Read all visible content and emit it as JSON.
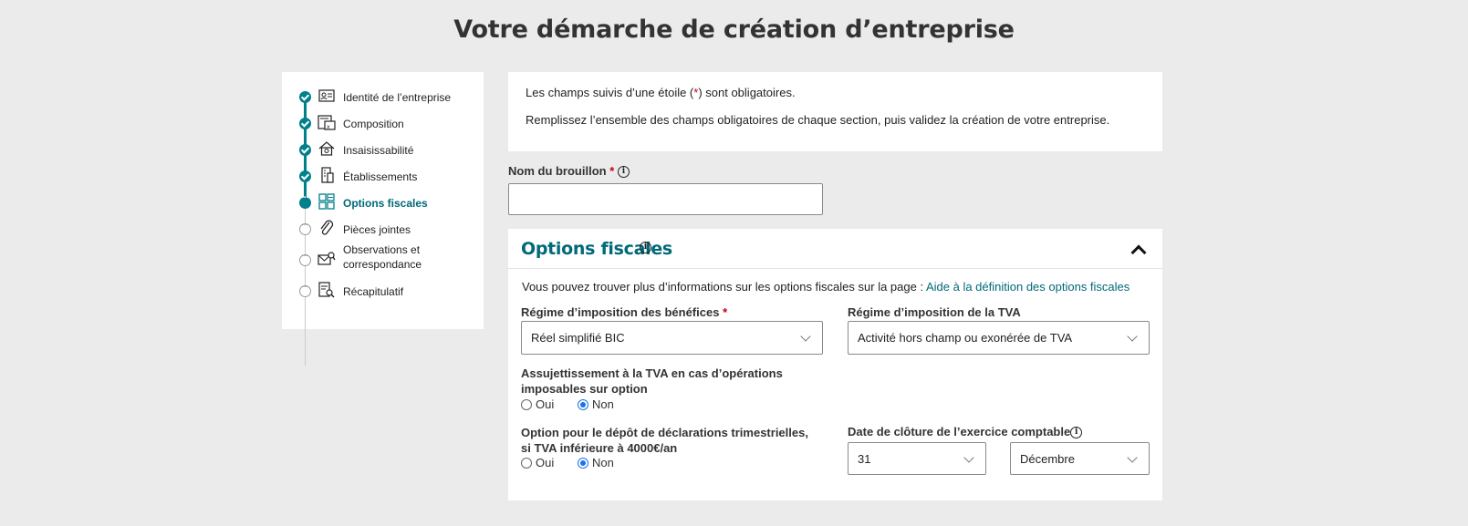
{
  "page": {
    "title": "Votre démarche de création d’entreprise"
  },
  "stepper": {
    "steps": [
      {
        "label": "Identité de l’entreprise",
        "status": "done",
        "icon": "id-card-icon"
      },
      {
        "label": "Composition",
        "status": "done",
        "icon": "people-document-icon"
      },
      {
        "label": "Insaisissabilité",
        "status": "done",
        "icon": "house-icon"
      },
      {
        "label": "Établissements",
        "status": "done",
        "icon": "building-icon"
      },
      {
        "label": "Options fiscales",
        "status": "current",
        "icon": "grid-options-icon"
      },
      {
        "label": "Pièces jointes",
        "status": "todo",
        "icon": "paperclip-icon"
      },
      {
        "label": "Observations et correspondance",
        "status": "todo",
        "icon": "mail-search-icon"
      },
      {
        "label": "Récapitulatif",
        "status": "todo",
        "icon": "document-search-icon"
      }
    ]
  },
  "info": {
    "line1_prefix": "Les champs suivis d’une étoile (",
    "line1_star": "*",
    "line1_suffix": ") sont obligatoires.",
    "line2": "Remplissez l’ensemble des champs obligatoires de chaque section, puis validez la création de votre entreprise."
  },
  "draft": {
    "label": "Nom du brouillon",
    "required_mark": "*",
    "value": ""
  },
  "section": {
    "title": "Options fiscales",
    "intro_text": "Vous pouvez trouver plus d’informations sur les options fiscales sur la page : ",
    "intro_link": "Aide à la définition des options fiscales",
    "benefits_regime": {
      "label": "Régime d’imposition des bénéfices",
      "required_mark": "*",
      "value": "Réel simplifié BIC"
    },
    "vat_regime": {
      "label": "Régime d’imposition de la TVA",
      "value": "Activité hors champ ou exonérée de TVA"
    },
    "vat_option": {
      "label_line1": "Assujettissement à la TVA en cas d’opérations",
      "label_line2": "imposables sur option",
      "options": [
        "Oui",
        "Non"
      ],
      "selected": "Non"
    },
    "quarterly": {
      "label_line1": "Option pour le dépôt de déclarations trimestrielles,",
      "label_line2": "si TVA inférieure à 4000€/an",
      "options": [
        "Oui",
        "Non"
      ],
      "selected": "Non"
    },
    "closing_date": {
      "label": "Date de clôture de l’exercice comptable",
      "day": "31",
      "month": "Décembre"
    }
  },
  "colors": {
    "accent": "#00808a",
    "required": "#c0001a",
    "radio_checked": "#1a73e8"
  }
}
